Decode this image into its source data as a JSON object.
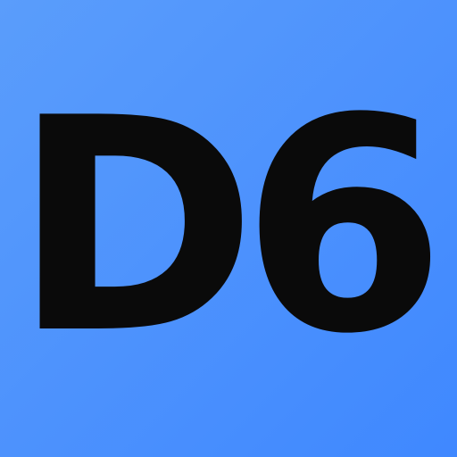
{
  "tile": {
    "text": "D6",
    "background_color": "#4a90fe",
    "text_color": "#0a0a0a"
  }
}
